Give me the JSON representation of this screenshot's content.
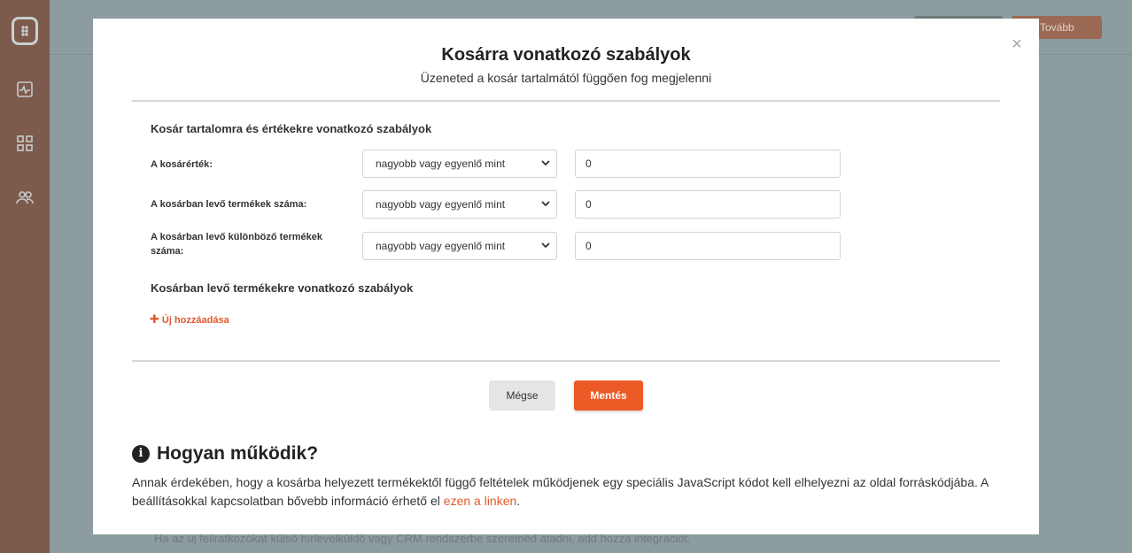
{
  "background": {
    "next_button_label": "Tovább",
    "footer_text": "Ha az új feliratkozókat külső hírlevélküldő vagy CRM rendszerbe szeretnéd átadni, add hozzá integrációt."
  },
  "modal": {
    "title": "Kosárra vonatkozó szabályok",
    "subtitle": "Üzeneted a kosár tartalmától függően fog megjelenni",
    "close_symbol": "×",
    "section_cart_values": "Kosár tartalomra és értékekre vonatkozó szabályok",
    "rules": [
      {
        "label": "A kosárérték:",
        "operator": "nagyobb vagy egyenlő mint",
        "value": "0"
      },
      {
        "label": "A kosárban levő termékek száma:",
        "operator": "nagyobb vagy egyenlő mint",
        "value": "0"
      },
      {
        "label": "A kosárban levő különböző termékek száma:",
        "operator": "nagyobb vagy egyenlő mint",
        "value": "0"
      }
    ],
    "section_products": "Kosárban levő termékekre vonatkozó szabályok",
    "add_new_label": "Új hozzáadása",
    "cancel_label": "Mégse",
    "save_label": "Mentés",
    "how_title": "Hogyan működik?",
    "how_text_before": "Annak érdekében, hogy a kosárba helyezett termékektől függő feltételek működjenek egy speciális JavaScript kódot kell elhelyezni az oldal forráskódjába. A beállításokkal kapcsolatban bővebb információ érhető el ",
    "how_link": "ezen a linken",
    "how_text_after": "."
  },
  "colors": {
    "accent": "#ec5a25",
    "sidebar": "#7d5b4c"
  }
}
